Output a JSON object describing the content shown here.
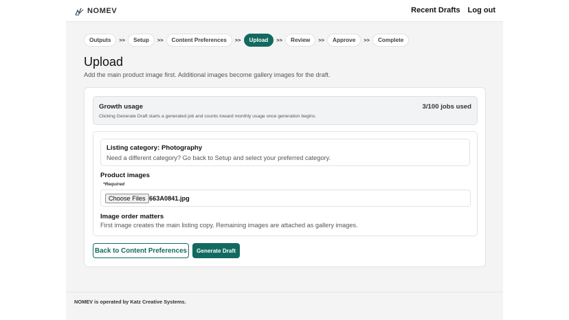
{
  "brand": {
    "name": "NOMEV",
    "icon": "pen-logo-icon"
  },
  "nav": {
    "recent_drafts": "Recent Drafts",
    "log_out": "Log out"
  },
  "steps": [
    {
      "label": "Outputs"
    },
    {
      "label": "Setup"
    },
    {
      "label": "Content Preferences"
    },
    {
      "label": "Upload",
      "active": true
    },
    {
      "label": "Review"
    },
    {
      "label": "Approve"
    },
    {
      "label": "Complete"
    }
  ],
  "step_separator": ">>",
  "page": {
    "title": "Upload",
    "subtitle": "Add the main product image first. Additional images become gallery images for the draft."
  },
  "usage": {
    "title": "Growth usage",
    "count": "3/100 jobs used",
    "note": "Clicking Generate Draft starts a generated job and counts toward monthly usage once generation begins."
  },
  "category": {
    "title": "Listing category: Photography",
    "note": "Need a different category? Go back to Setup and select your preferred category."
  },
  "product_images": {
    "label": "Product images",
    "required": "*Required",
    "choose_button": "Choose Files",
    "file_name": "663A0841.jpg"
  },
  "order": {
    "title": "Image order matters",
    "note": "First image creates the main listing copy. Remaining images are attached as gallery images."
  },
  "actions": {
    "back": "Back to Content Preferences",
    "generate": "Generate Draft"
  },
  "footer": {
    "text": "NOMEV is operated by Katz Creative Systems."
  },
  "colors": {
    "accent": "#12695f",
    "page_bg": "#f4f4f4"
  }
}
